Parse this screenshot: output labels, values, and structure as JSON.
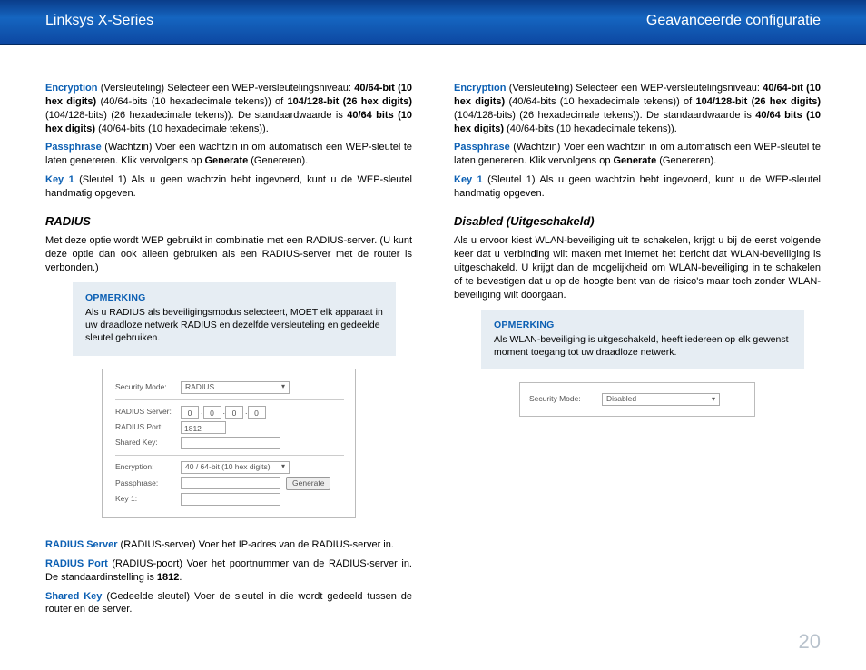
{
  "header": {
    "left": "Linksys X-Series",
    "right": "Geavanceerde configuratie"
  },
  "common": {
    "enc_term": "Encryption",
    "enc_text1": " (Versleuteling) Selecteer een WEP-versleutelingsniveau: ",
    "enc_b1": "40/64-bit (10 hex digits)",
    "enc_text2": " (40/64-bits (10 hexadecimale tekens)) of ",
    "enc_b2": "104/128-bit (26 hex digits)",
    "enc_text3": " (104/128-bits) (26 hexadecimale tekens)). De standaardwaarde is ",
    "enc_b3": "40/64 bits (10 hex digits)",
    "enc_text4": " (40/64-bits (10 hexadecimale tekens)).",
    "pass_term": "Passphrase",
    "pass_text1": " (Wachtzin) Voer een wachtzin in om automatisch een WEP-sleutel te laten genereren. Klik vervolgens op ",
    "pass_b1": "Generate",
    "pass_text2": " (Genereren).",
    "key_term": "Key 1",
    "key_text": " (Sleutel 1) Als u geen wachtzin hebt ingevoerd, kunt u de WEP-sleutel handmatig opgeven."
  },
  "left": {
    "h_radius": "RADIUS",
    "radius_intro": "Met deze optie wordt WEP gebruikt in combinatie met een RADIUS-server. (U kunt deze optie dan ook alleen gebruiken als een RADIUS-server met de router is verbonden.)",
    "note_title": "OPMERKING",
    "note_body": "Als u RADIUS als beveiligingsmodus selecteert, MOET elk apparaat in uw draadloze netwerk RADIUS en dezelfde versleuteling en gedeelde sleutel gebruiken.",
    "ui": {
      "sec_mode_label": "Security Mode:",
      "sec_mode_value": "RADIUS",
      "server_label": "RADIUS Server:",
      "ip0": "0",
      "ip1": "0",
      "ip2": "0",
      "ip3": "0",
      "port_label": "RADIUS Port:",
      "port_value": "1812",
      "shared_label": "Shared Key:",
      "enc_label": "Encryption:",
      "enc_value": "40 / 64-bit (10 hex digits)",
      "pass_label": "Passphrase:",
      "gen_btn": "Generate",
      "key1_label": "Key 1:"
    },
    "srv_term": "RADIUS Server",
    "srv_text": " (RADIUS-server) Voer het IP-adres van de RADIUS-server in.",
    "port_term": "RADIUS Port",
    "port_text1": " (RADIUS-poort) Voer het poortnummer van de RADIUS-server in. De standaardinstelling is ",
    "port_b": "1812",
    "port_text2": ".",
    "sk_term": "Shared Key",
    "sk_text": " (Gedeelde sleutel) Voer de sleutel in die wordt gedeeld tussen de router en de server."
  },
  "right": {
    "h_disabled": "Disabled (Uitgeschakeld)",
    "disabled_body": "Als u ervoor kiest WLAN-beveiliging uit te schakelen, krijgt u bij de eerst volgende keer dat u verbinding wilt maken met internet het bericht dat WLAN-beveiliging is uitgeschakeld. U krijgt dan de mogelijkheid om WLAN-beveiliging in te schakelen of te bevestigen dat u op de hoogte bent van de risico's maar toch zonder WLAN-beveiliging wilt doorgaan.",
    "note_title": "OPMERKING",
    "note_body": "Als WLAN-beveiliging is uitgeschakeld, heeft iedereen op elk gewenst moment toegang tot uw draadloze netwerk.",
    "ui": {
      "sec_mode_label": "Security Mode:",
      "sec_mode_value": "Disabled"
    }
  },
  "page_number": "20"
}
